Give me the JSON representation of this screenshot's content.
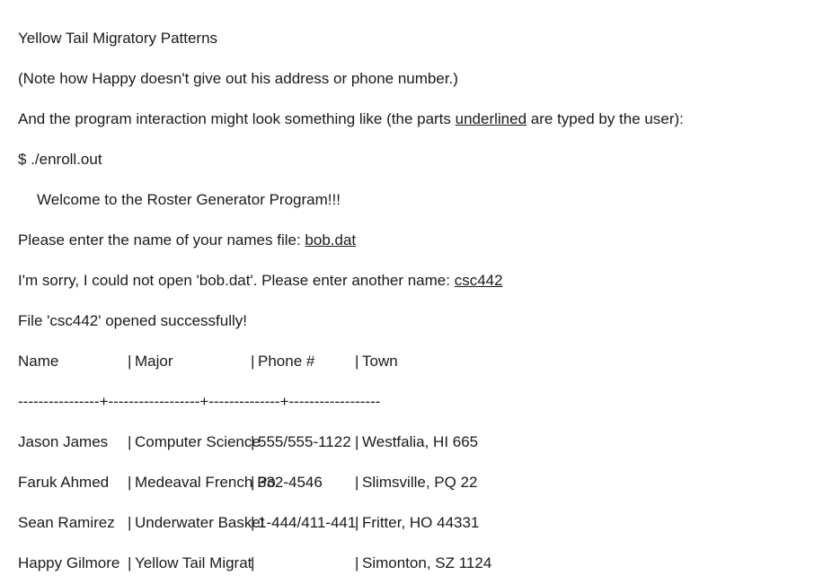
{
  "document": {
    "lines": [
      {
        "id": "title",
        "text": "Yellow Tail Migratory Patterns"
      },
      {
        "id": "note",
        "text": "(Note how Happy doesn't give out his address or phone number.)"
      },
      {
        "id": "intro_pre",
        "text": "And the program interaction might look something like (the parts "
      },
      {
        "id": "intro_u",
        "text": "underlined"
      },
      {
        "id": "intro_post",
        "text": " are typed by the user):"
      },
      {
        "id": "command",
        "text": "$ ./enroll.out"
      },
      {
        "id": "welcome",
        "text": "Welcome to the Roster Generator Program!!!"
      },
      {
        "id": "prompt1_pre",
        "text": "Please enter the name of your names file: "
      },
      {
        "id": "prompt1_u",
        "text": "bob.dat"
      },
      {
        "id": "prompt2_pre",
        "text": "I'm sorry, I could not open 'bob.dat'. Please enter another name: "
      },
      {
        "id": "prompt2_u",
        "text": "csc442"
      },
      {
        "id": "opened",
        "text": "File 'csc442' opened successfully!"
      }
    ],
    "terminal": {
      "command": "$ ./enroll.out",
      "welcome_message": "Welcome to the Roster Generator Program!!!",
      "prompt_names_file": "Please enter the name of your names file: ",
      "user_input_1": "bob.dat",
      "error_and_reprompt": "I'm sorry, I could not open 'bob.dat'. Please enter another name: ",
      "user_input_2": "csc442",
      "success_message": "File 'csc442' opened successfully!"
    },
    "roster_table": {
      "separator": "|",
      "headers": {
        "name": "Name",
        "major": "Major",
        "phone": "Phone #",
        "town": "Town"
      },
      "divider": "----------------+------------------+--------------+------------------",
      "rows": [
        {
          "name": "Jason James",
          "major": "Computer Science",
          "phone": "555/555-1122",
          "town": "Westfalia, HI 665"
        },
        {
          "name": "Faruk Ahmed",
          "major": "Medeaval French Po",
          "phone": "332-4546",
          "town": "Slimsville, PQ 22"
        },
        {
          "name": "Sean Ramirez",
          "major": "Underwater Basket",
          "phone": "1-444/411-441",
          "town": "Fritter, HO 44331"
        },
        {
          "name": "Happy Gilmore",
          "major": "Yellow Tail Migrat",
          "phone": "",
          "town": "Simonton, SZ 1124"
        }
      ]
    },
    "colors": {
      "background": "#ffffff",
      "text": "#1a1a1a"
    }
  }
}
